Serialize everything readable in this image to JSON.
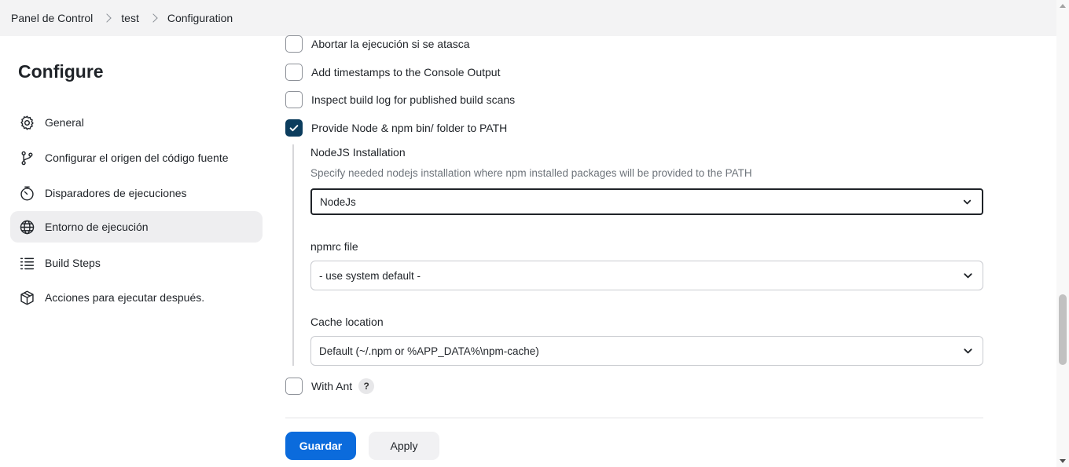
{
  "breadcrumb": {
    "items": [
      "Panel de Control",
      "test",
      "Configuration"
    ]
  },
  "sidebar": {
    "title": "Configure",
    "items": [
      {
        "label": "General",
        "icon": "gear-icon"
      },
      {
        "label": "Configurar el origen del código fuente",
        "icon": "branch-icon"
      },
      {
        "label": "Disparadores de ejecuciones",
        "icon": "timer-icon"
      },
      {
        "label": "Entorno de ejecución",
        "icon": "globe-icon",
        "active": true
      },
      {
        "label": "Build Steps",
        "icon": "list-icon"
      },
      {
        "label": "Acciones para ejecutar después.",
        "icon": "package-icon"
      }
    ]
  },
  "options": {
    "abort_stuck": {
      "label": "Abortar la ejecución si se atasca",
      "checked": false
    },
    "timestamps": {
      "label": "Add timestamps to the Console Output",
      "checked": false
    },
    "inspect_build_log": {
      "label": "Inspect build log for published build scans",
      "checked": false
    },
    "provide_node": {
      "label": "Provide Node & npm bin/ folder to PATH",
      "checked": true
    },
    "with_ant": {
      "label": "With Ant",
      "checked": false,
      "help": "?"
    }
  },
  "node": {
    "installation_label": "NodeJS Installation",
    "installation_desc": "Specify needed nodejs installation where npm installed packages will be provided to the PATH",
    "installation_value": "NodeJs",
    "npmrc_label": "npmrc file",
    "npmrc_value": "- use system default -",
    "cache_label": "Cache location",
    "cache_value": "Default (~/.npm or %APP_DATA%\\npm-cache)"
  },
  "actions": {
    "save_label": "Guardar",
    "apply_label": "Apply"
  },
  "colors": {
    "primary": "#0b6bdc",
    "checkbox_checked": "#0b3c5d",
    "active_nav_bg": "#eeeef0"
  }
}
